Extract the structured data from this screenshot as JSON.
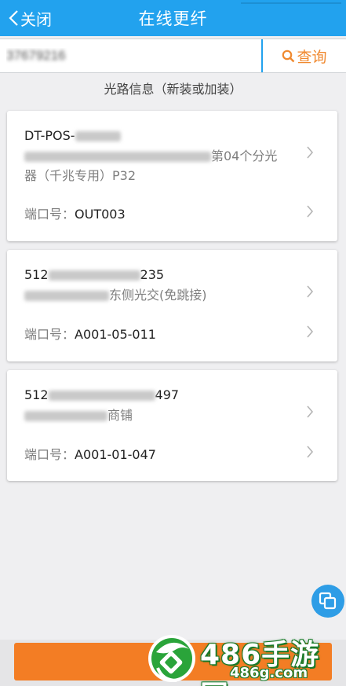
{
  "header": {
    "back_label": "关闭",
    "title": "在线更纤"
  },
  "search": {
    "value": "37679216",
    "button_label": "查询"
  },
  "section_title": "光路信息（新装或加装）",
  "cards": [
    {
      "line1_prefix": "DT-POS-",
      "line2_suffix": "第04个分光",
      "line3": "器（千兆专用）P32",
      "port_label": "端口号：",
      "port_value": "OUT003"
    },
    {
      "line1_prefix": "512",
      "line1_suffix": "235",
      "line2_suffix": "东侧光交(免跳接)",
      "port_label": "端口号：",
      "port_value": "A001-05-011"
    },
    {
      "line1_prefix": "512",
      "line1_suffix": "497",
      "line2_suffix": "商铺",
      "port_label": "端口号：",
      "port_value": "A001-01-047"
    }
  ],
  "watermark": {
    "text": "486手游网",
    "url": "486g.com"
  },
  "colors": {
    "header": "#22a2ee",
    "accent_orange": "#f37d24",
    "search_text": "#f0892f",
    "background": "#efeff1"
  },
  "icons": [
    "back-chevron-icon",
    "search-icon",
    "chevron-right-icon",
    "copy-icon"
  ]
}
